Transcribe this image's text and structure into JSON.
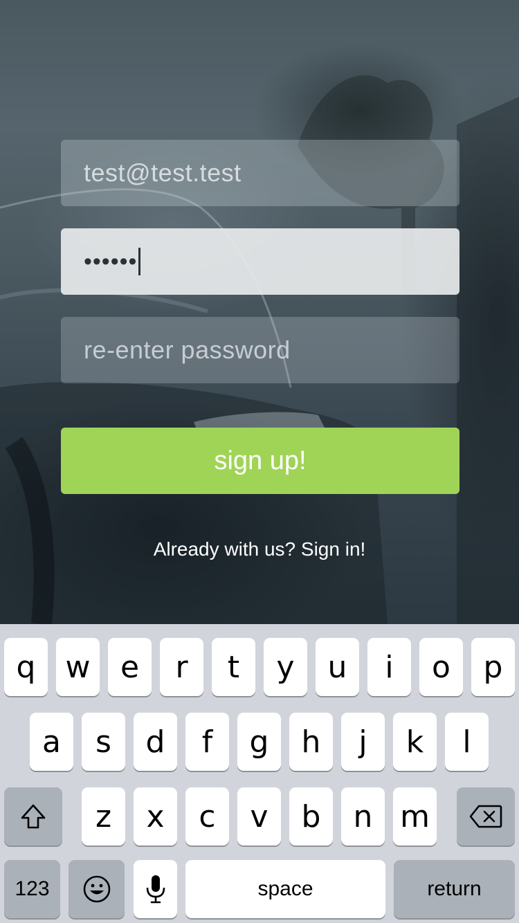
{
  "form": {
    "email_value": "test@test.test",
    "password_value": "••••••",
    "reenter_placeholder": "re-enter password",
    "signup_label": "sign up!",
    "signin_link": "Already with us? Sign in!"
  },
  "colors": {
    "accent_green": "#a0d456",
    "keyboard_bg": "#d1d4da",
    "key_dark": "#abb1b9"
  },
  "keyboard": {
    "row1": [
      "q",
      "w",
      "e",
      "r",
      "t",
      "y",
      "u",
      "i",
      "o",
      "p"
    ],
    "row2": [
      "a",
      "s",
      "d",
      "f",
      "g",
      "h",
      "j",
      "k",
      "l"
    ],
    "row3": [
      "z",
      "x",
      "c",
      "v",
      "b",
      "n",
      "m"
    ],
    "numbers_label": "123",
    "space_label": "space",
    "return_label": "return",
    "icons": [
      "shift-icon",
      "delete-icon",
      "emoji-icon",
      "microphone-icon"
    ]
  }
}
